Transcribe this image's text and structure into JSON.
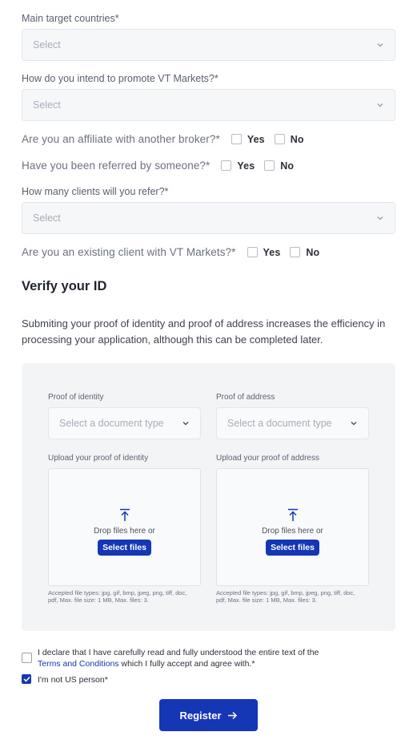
{
  "fields": {
    "target_countries": {
      "label": "Main target countries*",
      "placeholder": "Select"
    },
    "promote": {
      "label": "How do you intend to promote VT Markets?*",
      "placeholder": "Select"
    },
    "clients": {
      "label": "How many clients will you refer?*",
      "placeholder": "Select"
    }
  },
  "questions": {
    "affiliate": "Are you an affiliate with another broker?*",
    "referred": "Have you been referred by someone?*",
    "existing": "Are you an existing client with VT Markets?*",
    "yes": "Yes",
    "no": "No"
  },
  "verify": {
    "heading": "Verify your ID",
    "description": "Submiting your proof of identity and proof of address increases the efficiency in processing your application, although this can be completed later.",
    "identity_label": "Proof of identity",
    "address_label": "Proof of address",
    "doc_placeholder": "Select a document type",
    "upload_identity_label": "Upload your proof of identity",
    "upload_address_label": "Upload your proof of address",
    "drop_text": "Drop files here or",
    "select_files": "Select files",
    "accepted": "Accepted file types: jpg, gif, bmp, jpeg, png, tiff, doc, pdf, Max. file size: 1 MB, Max. files: 3."
  },
  "declaration": {
    "text_before": "I declare that I have carefully read and fully understood the entire text of the",
    "terms_link": "Terms and Conditions",
    "text_after": "which I fully accept and agree with.*",
    "us_person": "I'm not US person*"
  },
  "register_label": "Register",
  "colors": {
    "accent": "#1637b5",
    "panel": "#f3f4f6"
  },
  "icons": [
    "chevron-down-icon",
    "upload-icon",
    "check-icon",
    "arrow-right-icon"
  ]
}
